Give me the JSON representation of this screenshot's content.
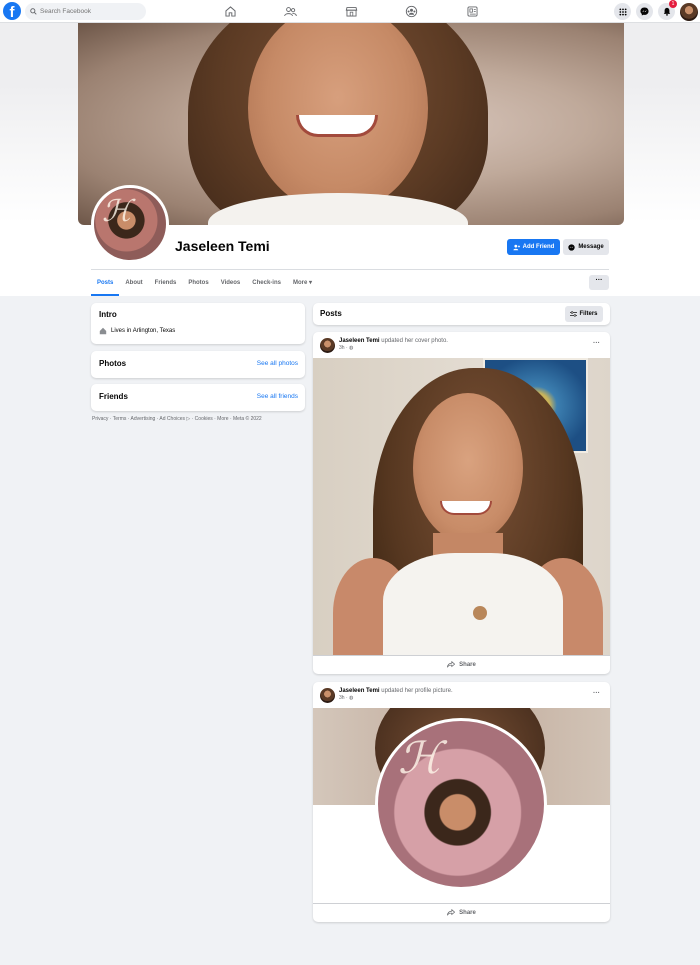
{
  "nav": {
    "logo_letter": "f",
    "search_placeholder": "Search Facebook",
    "center_icons": [
      "home-icon",
      "friends-icon",
      "marketplace-icon",
      "groups-icon",
      "gaming-icon"
    ],
    "right_icons": [
      "menu-grid-icon",
      "messenger-icon",
      "notifications-icon"
    ],
    "notification_count": "1"
  },
  "profile": {
    "name": "Jaseleen Temi",
    "add_friend_label": "Add Friend",
    "message_label": "Message",
    "more_label": "···",
    "tabs": [
      "Posts",
      "About",
      "Friends",
      "Photos",
      "Videos",
      "Check-ins",
      "More ▾"
    ],
    "active_tab": "Posts"
  },
  "intro": {
    "title": "Intro",
    "lives_prefix": "Lives in ",
    "lives_city": "Arlington, Texas"
  },
  "photos_card": {
    "title": "Photos",
    "link": "See all photos"
  },
  "friends_card": {
    "title": "Friends",
    "link": "See all friends"
  },
  "footer": "Privacy · Terms · Advertising · Ad Choices ▷ · Cookies · More · Meta © 2022",
  "posts_header": {
    "title": "Posts",
    "filters_label": "Filters"
  },
  "posts": [
    {
      "author": "Jaseleen Temi",
      "action": " updated her cover photo.",
      "time": "3h · ◍",
      "more": "···",
      "share_label": "Share"
    },
    {
      "author": "Jaseleen Temi",
      "action": " updated her profile picture.",
      "time": "3h · ◍",
      "more": "···",
      "share_label": "Share"
    }
  ],
  "colors": {
    "brand": "#1877f2",
    "background": "#f0f2f5",
    "notification": "#e41e3f"
  }
}
